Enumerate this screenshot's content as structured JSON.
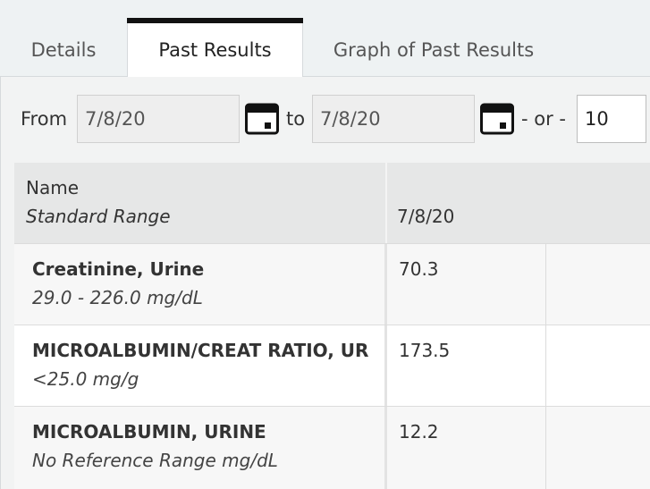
{
  "tabs": [
    {
      "label": "Details",
      "active": false
    },
    {
      "label": "Past Results",
      "active": true
    },
    {
      "label": "Graph of Past Results",
      "active": false
    }
  ],
  "filter": {
    "from_label": "From",
    "from_value": "7/8/20",
    "to_label": "to",
    "to_value": "7/8/20",
    "or_label": "- or -",
    "count_value": "10"
  },
  "table": {
    "header": {
      "name": "Name",
      "range": "Standard Range",
      "date": "7/8/20"
    },
    "rows": [
      {
        "name": "Creatinine, Urine",
        "range": "29.0 - 226.0 mg/dL",
        "value": "70.3"
      },
      {
        "name": "MICROALBUMIN/CREAT RATIO, UR",
        "range": "<25.0 mg/g",
        "value": "173.5"
      },
      {
        "name": "MICROALBUMIN, URINE",
        "range": "No Reference Range mg/dL",
        "value": "12.2"
      }
    ]
  },
  "icons": {
    "calendar": "calendar-icon"
  },
  "colors": {
    "active_tab_indicator": "#111111",
    "tab_bar_bg": "#eef2f3",
    "table_header_bg": "#e6e7e7"
  }
}
